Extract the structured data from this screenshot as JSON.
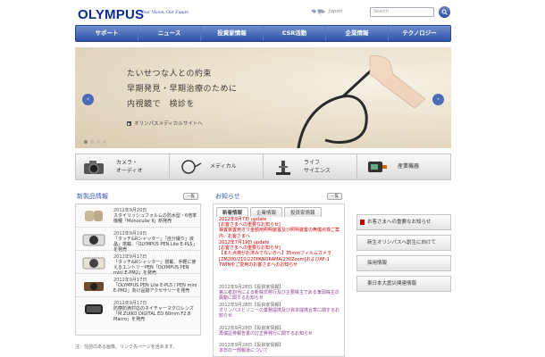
{
  "header": {
    "logo": "OLYMPUS",
    "tagline": "Your Vision, Our Future",
    "language": "Japan",
    "search_placeholder": "Search"
  },
  "nav": {
    "items": [
      "サポート",
      "ニュース",
      "投資家情報",
      "CSR活動",
      "企業情報",
      "テクノロジー"
    ]
  },
  "hero": {
    "line1": "たいせつな人との約束",
    "line2": "早期発見・早期治療のために",
    "line3": "内視鏡で　検診を",
    "link": "オリンパスメディカルサイトへ",
    "prev_arrow": "‹",
    "next_arrow": "›"
  },
  "categories": [
    {
      "label": "カメラ・\nオーディオ",
      "icon": "camera-icon"
    },
    {
      "label": "メディカル",
      "icon": "endoscope-icon"
    },
    {
      "label": "ライフ\nサイエンス",
      "icon": "microscope-icon"
    },
    {
      "label": "産業機器",
      "icon": "industrial-device-icon"
    }
  ],
  "products": {
    "title": "新製品情報",
    "more": "一覧",
    "items": [
      {
        "date": "2012年9月20日",
        "text": "スタイリッシュフォルムの防水型・6倍率機種「Monocular Ⅱ」新発売"
      },
      {
        "date": "2012年9月19日",
        "text": "「タッチ&Rシャッター」「自分撮り」液晶」搭載、「OLYMPUS PEN Lite E-PL5」を発売"
      },
      {
        "date": "2012年9月17日",
        "text": "「タッチ&Rシャッター」搭載、手軽に使えるエントリーPEN「OLYMPUS PEN mini E-PM2」を発売"
      },
      {
        "date": "2012年9月17日",
        "text": "「OLYMPUS PEN Lite E-PL5 / PEN mini E-PM2」向け品揃アクセサリーを発売"
      },
      {
        "date": "2012年9月17日",
        "text": "防塵防滴対応のネイチャーマクロレンズ「M.ZUIKO DIGITAL ED 60mm F2.8 Macro」を発売"
      }
    ]
  },
  "news": {
    "title": "お知らせ",
    "more": "一覧",
    "tabs": [
      "新着情報",
      "企業情報",
      "投資家情報"
    ],
    "items": [
      {
        "date": "2012年9月7日 update",
        "text": "[お客さまへの重要なお知らせ]\n株置装置用オリ金額用照明装置及び照明装置の無償点検ご案内／お客さまへ",
        "style": "red"
      },
      {
        "date": "2012年7月19日 update",
        "text": "[お客さまへの重要なお知らせ]\n【また点検がお済みでない方へ】35mmフィルムカメラ[ZM200/210/220PANORAMA/230Zoom]およびAF-1 TWINをご愛用のお客さまへのお知らせ",
        "style": "red"
      },
      {
        "date": "2012年9月28日【投資家情報】",
        "text": "第三者割当による新株式発行及び主要株主である筆頭株主の異動に関するお知らせ",
        "style": "purple"
      },
      {
        "date": "2012年9月28日【投資家情報】",
        "text": "オリンパスとソニーの業務提携及び資本提携合意に関するお知らせ",
        "style": "purple"
      },
      {
        "date": "2012年9月28日【投資家情報】",
        "text": "再償証券報告書の訂正券発行に関するお知らせ",
        "style": "purple"
      },
      {
        "date": "2012年9月28日【投資家情報】",
        "text": "本日の一部報道について",
        "style": "purple"
      }
    ]
  },
  "side_links": [
    "お客さまへの重要なお知らせ",
    "新生オリンパスへ創生に向けて",
    "採用情報",
    "東日本大震災関連情報"
  ],
  "footer": {
    "note": "注：住前のある画像、リンク先ページを含めます。"
  }
}
